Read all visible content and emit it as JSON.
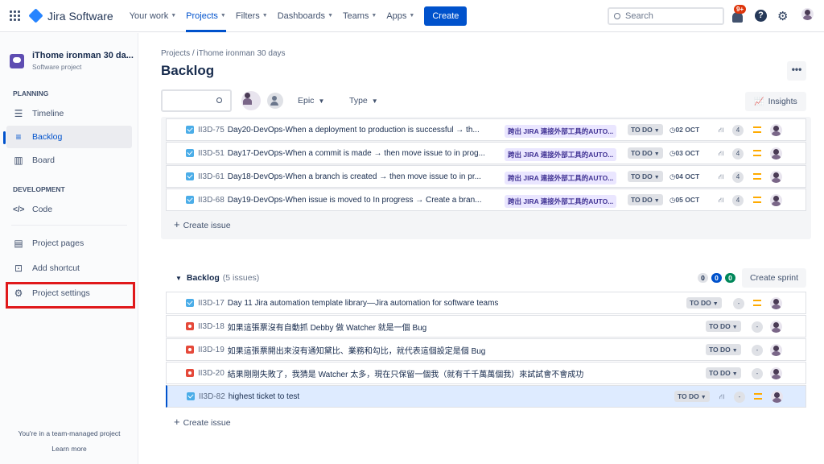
{
  "topnav": {
    "app_name": "Jira Software",
    "items": [
      {
        "label": "Your work"
      },
      {
        "label": "Projects"
      },
      {
        "label": "Filters"
      },
      {
        "label": "Dashboards"
      },
      {
        "label": "Teams"
      },
      {
        "label": "Apps"
      }
    ],
    "create_label": "Create",
    "search_placeholder": "Search",
    "notification_count": "9+",
    "help_glyph": "?"
  },
  "sidebar": {
    "project_name": "iThome ironman 30 da...",
    "project_type": "Software project",
    "planning_title": "PLANNING",
    "development_title": "DEVELOPMENT",
    "items": {
      "timeline": "Timeline",
      "backlog": "Backlog",
      "board": "Board",
      "code": "Code",
      "project_pages": "Project pages",
      "add_shortcut": "Add shortcut",
      "project_settings": "Project settings"
    },
    "footer_text": "You're in a team-managed project",
    "learn_more": "Learn more"
  },
  "main": {
    "breadcrumb_projects": "Projects",
    "breadcrumb_project": "iThome ironman 30 days",
    "title": "Backlog",
    "more": "•••",
    "filters": {
      "epic": "Epic",
      "type": "Type",
      "insights": "Insights"
    }
  },
  "sprint": {
    "rows": [
      {
        "key": "II3D-75",
        "summary": "Day20-DevOps-When a deployment to production is successful → th...",
        "epic": "跨出 JIRA 連接外部工具的AUTO...",
        "status": "TO DO",
        "date": "02 OCT",
        "estimate": "4"
      },
      {
        "key": "II3D-51",
        "summary": "Day17-DevOps-When a commit is made → then move issue to in prog...",
        "epic": "跨出 JIRA 連接外部工具的AUTO...",
        "status": "TO DO",
        "date": "03 OCT",
        "estimate": "4"
      },
      {
        "key": "II3D-61",
        "summary": "Day18-DevOps-When a branch is created → then move issue to in pr...",
        "epic": "跨出 JIRA 連接外部工具的AUTO...",
        "status": "TO DO",
        "date": "04 OCT",
        "estimate": "4"
      },
      {
        "key": "II3D-68",
        "summary": "Day19-DevOps-When issue is moved to In progress → Create a bran...",
        "epic": "跨出 JIRA 連接外部工具的AUTO...",
        "status": "TO DO",
        "date": "05 OCT",
        "estimate": "4"
      }
    ],
    "create_issue": "Create issue"
  },
  "backlog": {
    "title": "Backlog",
    "count": "(5 issues)",
    "points": [
      "0",
      "0",
      "0"
    ],
    "create_sprint": "Create sprint",
    "rows": [
      {
        "key": "II3D-17",
        "summary": "Day 11 Jira automation template library—Jira automation for software teams",
        "type": "story",
        "status": "TO DO",
        "estimate": "-"
      },
      {
        "key": "II3D-18",
        "summary": "如果這張票沒有自動抓 Debby 做 Watcher 就是一個 Bug",
        "type": "bug",
        "status": "TO DO",
        "estimate": "-"
      },
      {
        "key": "II3D-19",
        "summary": "如果這張票開出來沒有通知黛比、業務和勾比，就代表這個設定是個 Bug",
        "type": "bug",
        "status": "TO DO",
        "estimate": "-"
      },
      {
        "key": "II3D-20",
        "summary": "結果剛剛失敗了，我猜是 Watcher 太多，現在只保留一個我（就有千千萬萬個我）來試試會不會成功",
        "type": "bug",
        "status": "TO DO",
        "estimate": "-"
      },
      {
        "key": "II3D-82",
        "summary": "highest ticket to test",
        "type": "story",
        "status": "TO DO",
        "estimate": "-"
      }
    ],
    "create_issue": "Create issue"
  },
  "colors": {
    "brand_blue": "#0052cc",
    "highlight_red": "#e0191b",
    "epic_purple": "#403294"
  }
}
